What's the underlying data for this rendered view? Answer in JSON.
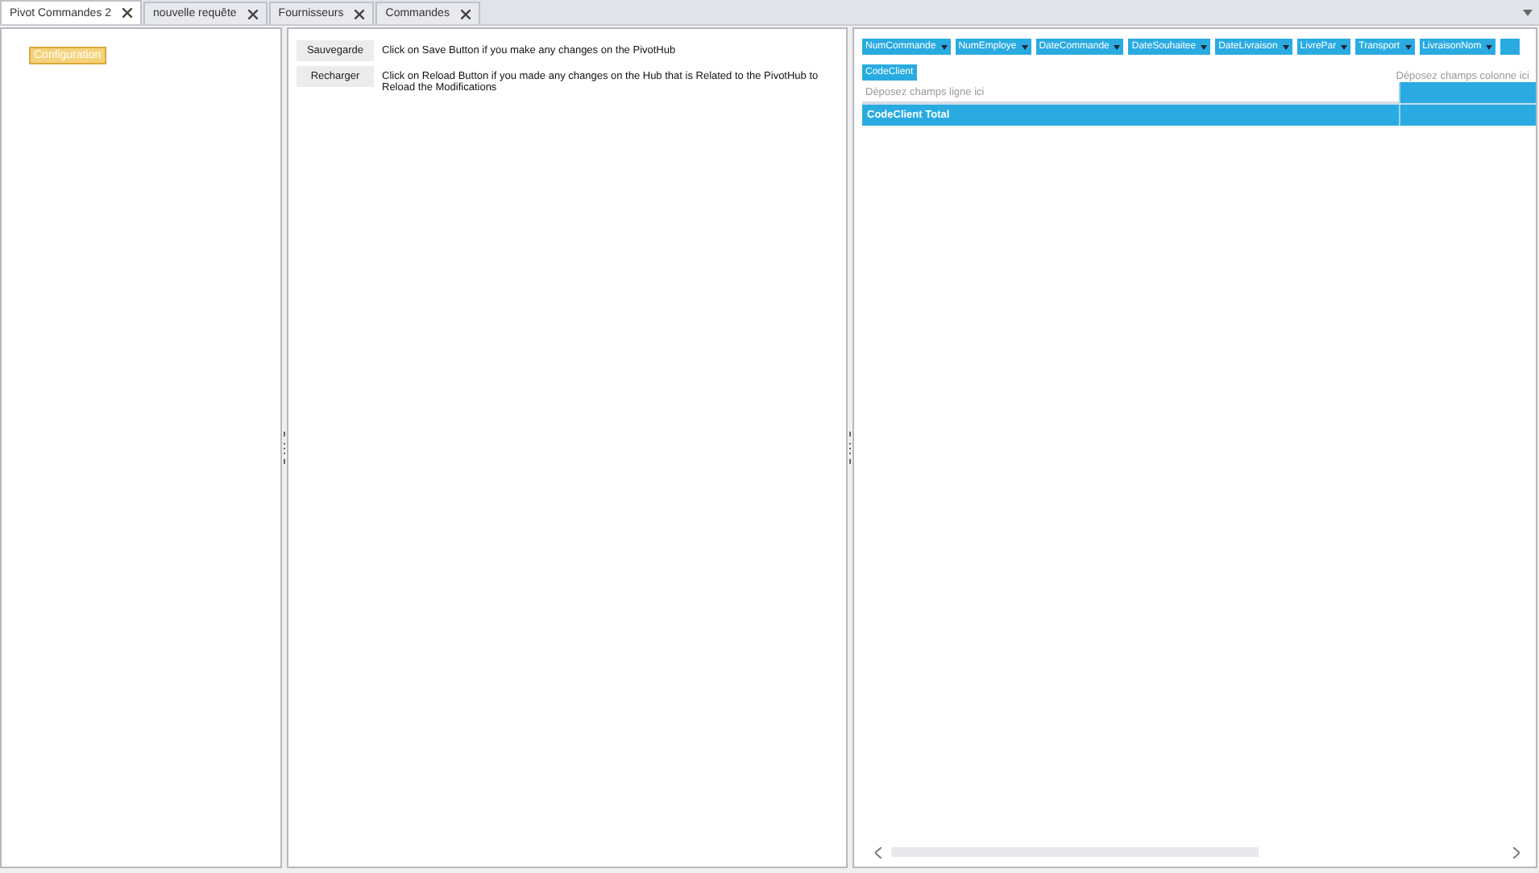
{
  "tabs": [
    {
      "label": "Pivot Commandes 2",
      "selected": true
    },
    {
      "label": "nouvelle requête",
      "selected": false
    },
    {
      "label": "Fournisseurs",
      "selected": false
    },
    {
      "label": "Commandes",
      "selected": false
    }
  ],
  "left_panel": {
    "button": "Configuration"
  },
  "middle_panel": {
    "actions": [
      {
        "button": "Sauvegarde",
        "description": "Click on Save Button if you make any changes on the PivotHub"
      },
      {
        "button": "Recharger",
        "description": "Click on Reload Button if you made any changes on the Hub that is Related to the PivotHub to Reload the Modifications"
      }
    ]
  },
  "pivot": {
    "filter_fields": [
      "NumCommande",
      "NumEmploye",
      "DateCommande",
      "DateSouhaitee",
      "DateLivraison",
      "LivrePar",
      "Transport",
      "LivraisonNom"
    ],
    "row_fields": [
      "CodeClient"
    ],
    "column_drop_hint": "Déposez champs colonne ici",
    "row_drop_hint": "Déposez champs ligne ici",
    "total_label": "CodeClient Total"
  }
}
